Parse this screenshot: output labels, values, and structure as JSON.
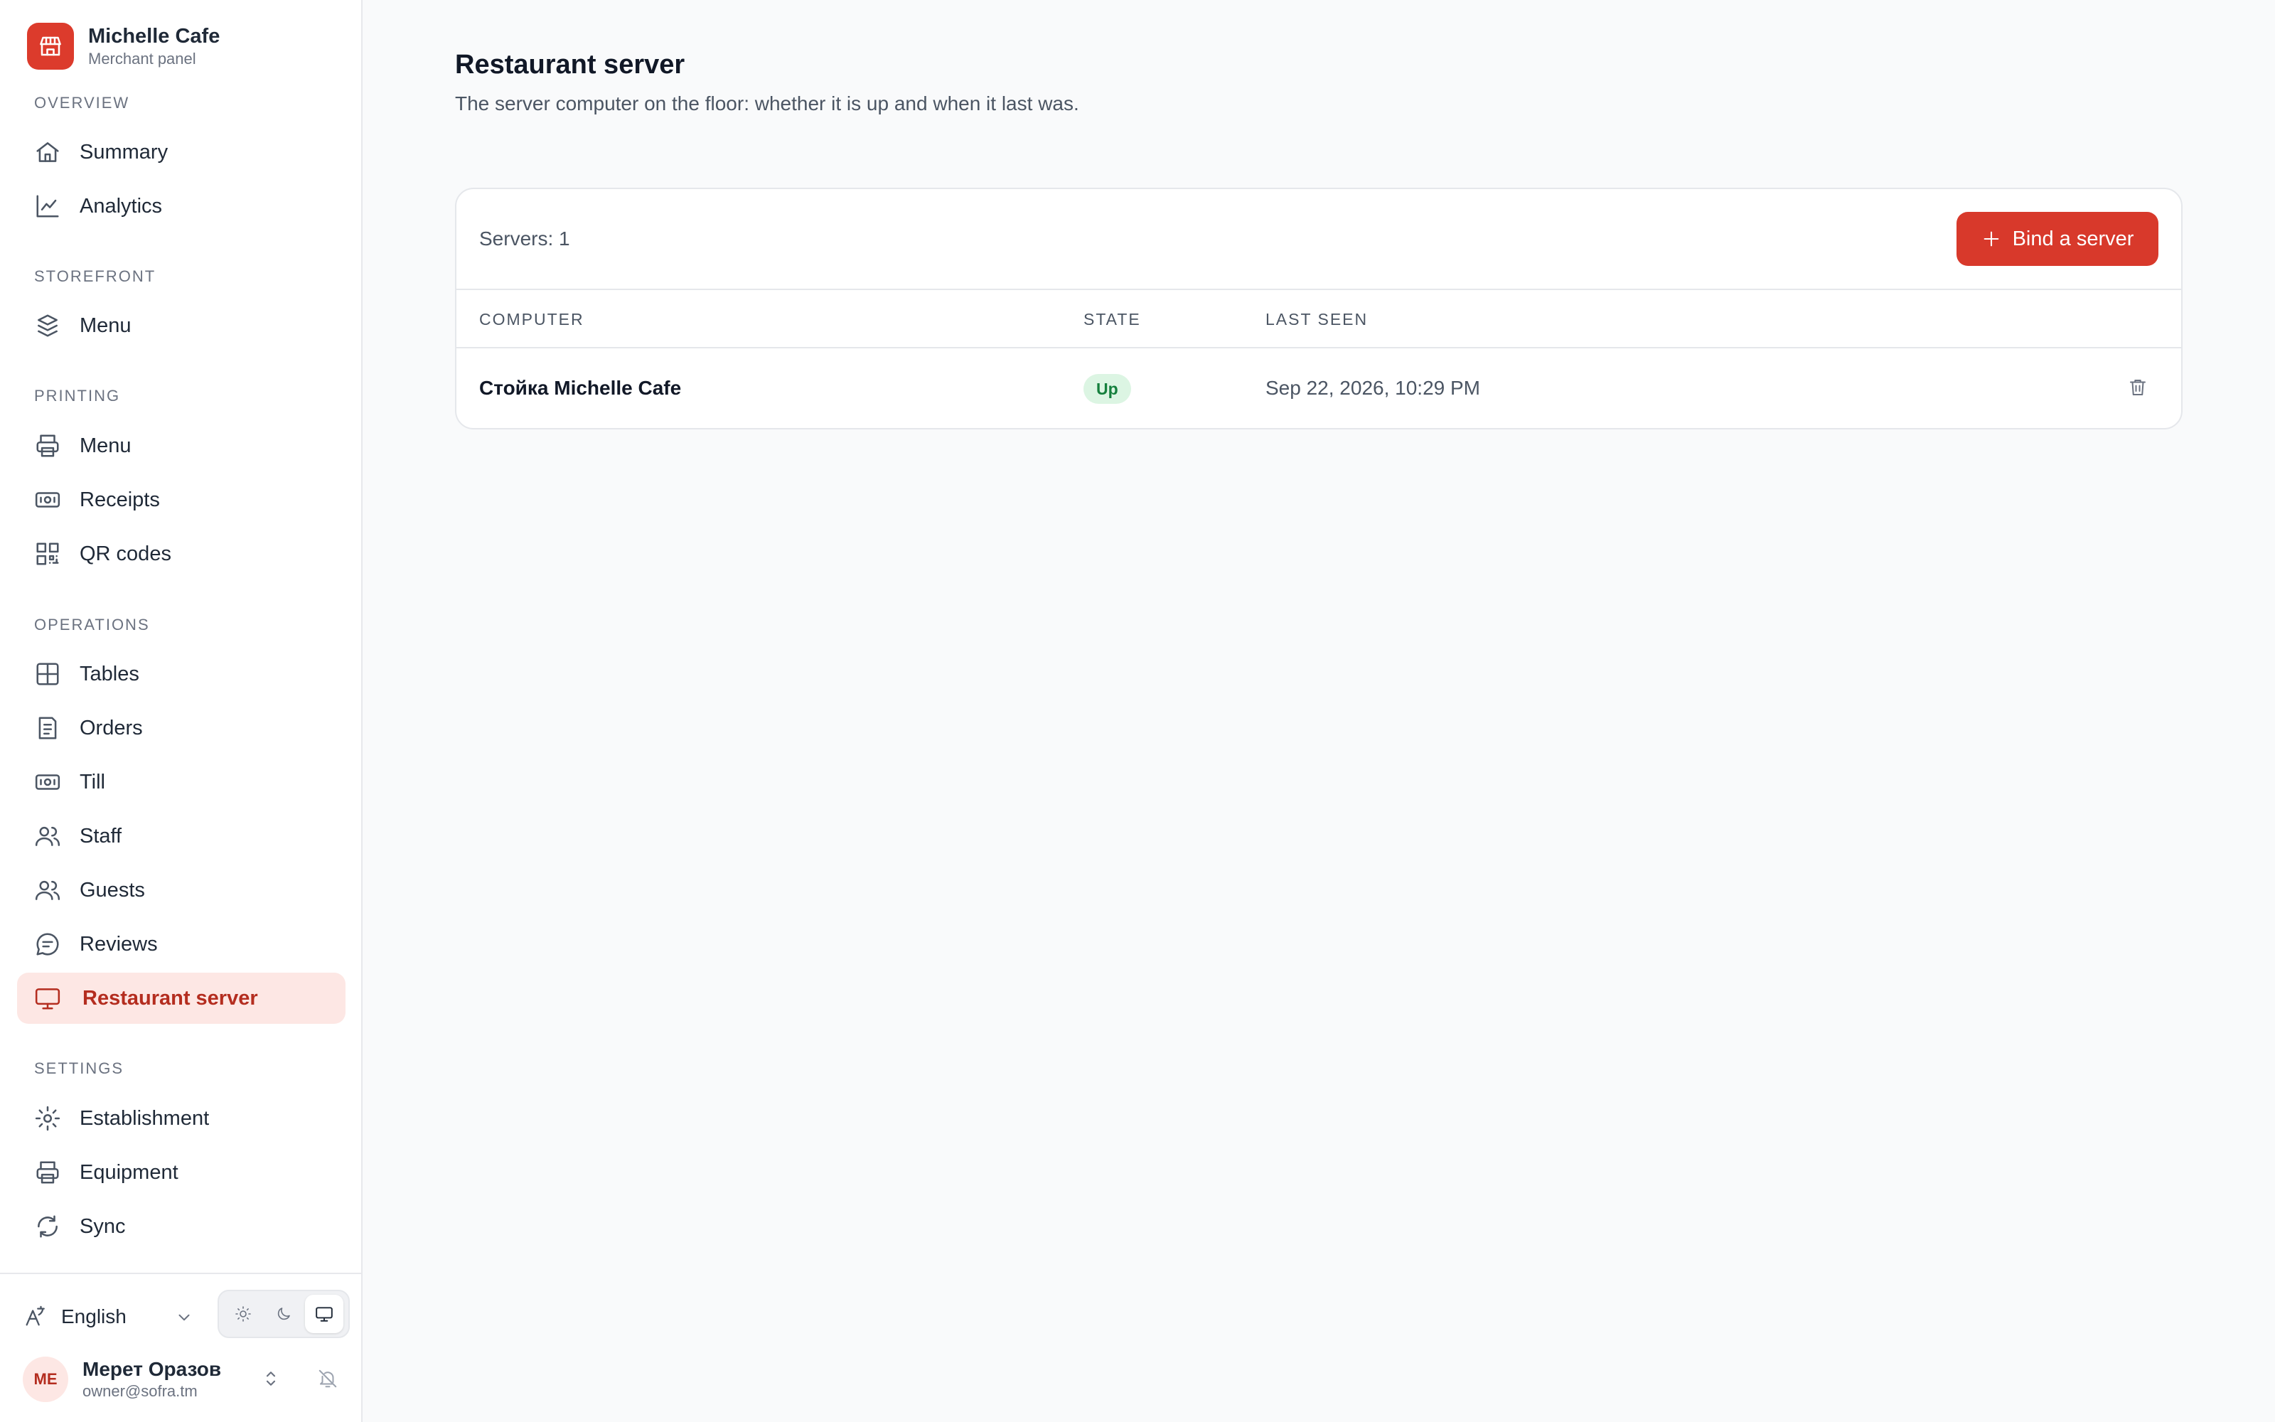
{
  "brand": {
    "name": "Michelle Cafe",
    "subtitle": "Merchant panel",
    "accent": "#dc3b2c",
    "logo_icon": "storefront-icon"
  },
  "sidebar": {
    "sections": [
      {
        "label": "OVERVIEW",
        "items": [
          {
            "label": "Summary",
            "icon": "home-icon"
          },
          {
            "label": "Analytics",
            "icon": "chart-line-icon"
          }
        ]
      },
      {
        "label": "STOREFRONT",
        "items": [
          {
            "label": "Menu",
            "icon": "box-stack-icon"
          }
        ]
      },
      {
        "label": "PRINTING",
        "items": [
          {
            "label": "Menu",
            "icon": "printer-icon"
          },
          {
            "label": "Receipts",
            "icon": "banknote-icon"
          },
          {
            "label": "QR codes",
            "icon": "qr-code-icon"
          }
        ]
      },
      {
        "label": "OPERATIONS",
        "items": [
          {
            "label": "Tables",
            "icon": "grid-icon"
          },
          {
            "label": "Orders",
            "icon": "receipt-icon"
          },
          {
            "label": "Till",
            "icon": "cash-icon"
          },
          {
            "label": "Staff",
            "icon": "users-icon"
          },
          {
            "label": "Guests",
            "icon": "guests-icon"
          },
          {
            "label": "Reviews",
            "icon": "chat-icon"
          },
          {
            "label": "Restaurant server",
            "icon": "monitor-icon",
            "active": true
          }
        ]
      },
      {
        "label": "SETTINGS",
        "items": [
          {
            "label": "Establishment",
            "icon": "gear-icon"
          },
          {
            "label": "Equipment",
            "icon": "printer-icon"
          },
          {
            "label": "Sync",
            "icon": "refresh-icon"
          }
        ]
      }
    ],
    "footer": {
      "language": "English",
      "theme_options": [
        "sun-icon",
        "moon-icon",
        "monitor-icon"
      ],
      "theme_selected": "monitor-icon",
      "user": {
        "initials": "ME",
        "name": "Мерет Оразов",
        "email": "owner@sofra.tm"
      }
    }
  },
  "main": {
    "title": "Restaurant server",
    "subtitle": "The server computer on the floor: whether it is up and when it last was.",
    "count_label": "Servers: 1",
    "bind_button": "Bind a server",
    "columns": [
      "COMPUTER",
      "STATE",
      "LAST SEEN"
    ],
    "rows": [
      {
        "computer": "Стойка Michelle Cafe",
        "state": "Up",
        "last_seen": "Sep 22, 2026, 10:29 PM"
      }
    ]
  }
}
